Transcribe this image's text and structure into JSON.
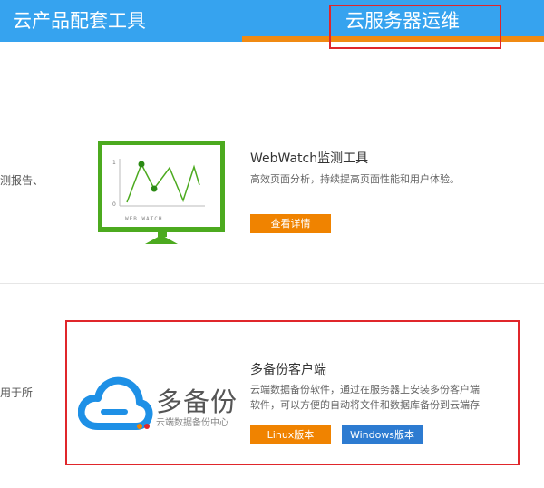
{
  "tabs": {
    "tab1": "云产品配套工具",
    "tab2": "云服务器运维"
  },
  "section1": {
    "cut_text": "测报告、",
    "monitor_label": "WEB WATCH",
    "axis_top": "1",
    "axis_bottom": "0",
    "title": "WebWatch监测工具",
    "desc": "高效页面分析，持续提高页面性能和用户体验。",
    "button": "查看详情"
  },
  "section2": {
    "cut_text": "用于所",
    "logo_text": "多备份",
    "logo_sub": "云端数据备份中心",
    "title": "多备份客户端",
    "desc_line1": "云端数据备份软件，通过在服务器上安装多份客户端",
    "desc_line2": "软件，可以方便的自动将文件和数据库备份到云端存",
    "button_linux": "Linux版本",
    "button_windows": "Windows版本"
  },
  "colors": {
    "tab_bg": "#36a3ef",
    "tab_underline": "#f08a13",
    "highlight_box": "#e0262b",
    "monitor_green": "#4caa1f",
    "button_orange": "#f08300",
    "button_blue": "#2d7bd1",
    "logo_blue": "#1e90e6"
  }
}
